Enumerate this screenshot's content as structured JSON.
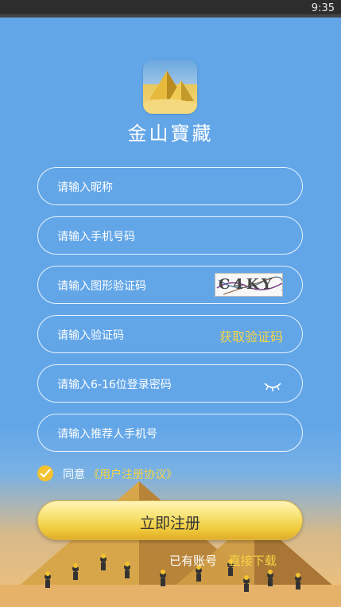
{
  "status_bar": {
    "time": "9:35"
  },
  "app": {
    "name": "金山寶藏"
  },
  "form": {
    "nickname_placeholder": "请输入昵称",
    "phone_placeholder": "请输入手机号码",
    "captcha_placeholder": "请输入图形验证码",
    "captcha_image_text": "C4KY",
    "sms_code_placeholder": "请输入验证码",
    "get_code_label": "获取验证码",
    "password_placeholder": "请输入6-16位登录密码",
    "referrer_placeholder": "请输入推荐人手机号"
  },
  "agreement": {
    "prefix": "同意",
    "link": "《用户注册协议》",
    "checked": true
  },
  "submit_label": "立即注册",
  "footer": {
    "have_account": "已有账号",
    "download": "直接下载"
  },
  "colors": {
    "background": "#62a6e8",
    "accent": "#f5d544",
    "button": "#f0c93a"
  }
}
